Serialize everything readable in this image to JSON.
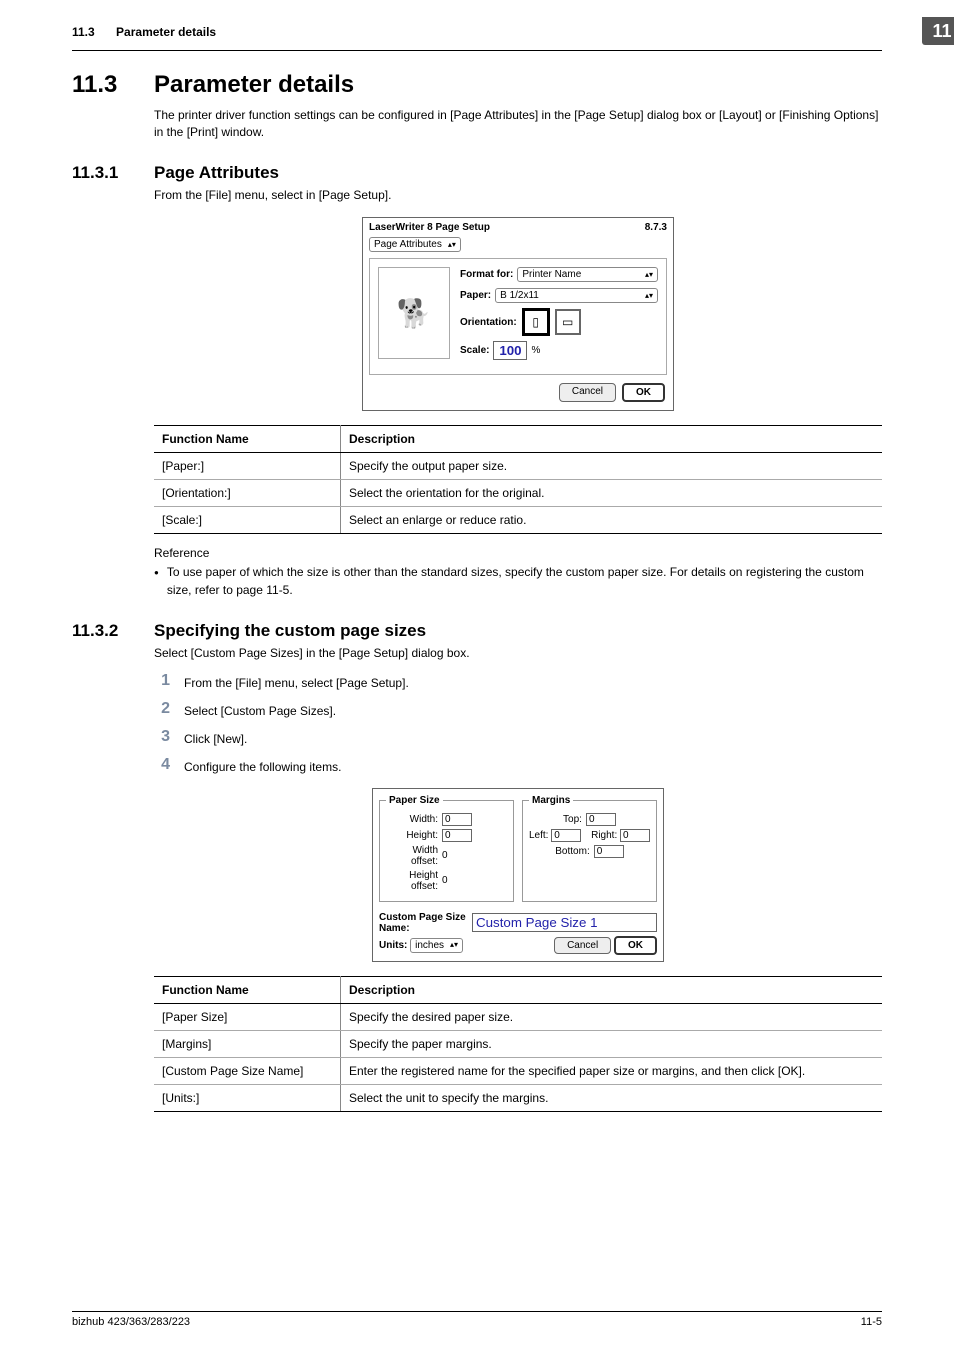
{
  "header": {
    "section_no": "11.3",
    "section_name": "Parameter details",
    "chapter": "11"
  },
  "h1": {
    "num": "11.3",
    "title": "Parameter details"
  },
  "intro": "The printer driver function settings can be configured in [Page Attributes] in the [Page Setup] dialog box or [Layout] or [Finishing Options] in the [Print] window.",
  "s1": {
    "num": "11.3.1",
    "title": "Page Attributes",
    "lead": "From the [File] menu, select in [Page Setup].",
    "dlg": {
      "title": "LaserWriter 8 Page Setup",
      "version": "8.7.3",
      "tab": "Page Attributes",
      "format_for_label": "Format for:",
      "format_for_value": "Printer Name",
      "paper_label": "Paper:",
      "paper_value": "B 1/2x11",
      "orientation_label": "Orientation:",
      "scale_label": "Scale:",
      "scale_value": "100",
      "scale_suffix": "%",
      "cancel": "Cancel",
      "ok": "OK"
    },
    "table": {
      "h1": "Function Name",
      "h2": "Description",
      "rows": [
        {
          "n": "[Paper:]",
          "d": "Specify the output paper size."
        },
        {
          "n": "[Orientation:]",
          "d": "Select the orientation for the original."
        },
        {
          "n": "[Scale:]",
          "d": "Select an enlarge or reduce ratio."
        }
      ]
    },
    "ref_label": "Reference",
    "ref_item": "To use paper of which the size is other than the standard sizes, specify the custom paper size. For details on registering the custom size, refer to page 11-5."
  },
  "s2": {
    "num": "11.3.2",
    "title": "Specifying the custom page sizes",
    "lead": "Select [Custom Page Sizes] in the [Page Setup] dialog box.",
    "steps": [
      "From the [File] menu, select [Page Setup].",
      "Select [Custom Page Sizes].",
      "Click [New].",
      "Configure the following items."
    ],
    "dlg": {
      "papersize_legend": "Paper Size",
      "margins_legend": "Margins",
      "width_label": "Width:",
      "width_value": "0",
      "height_label": "Height:",
      "height_value": "0",
      "widthoff_label": "Width offset:",
      "widthoff_value": "0",
      "heightoff_label": "Height offset:",
      "heightoff_value": "0",
      "top_label": "Top:",
      "top_value": "0",
      "left_label": "Left:",
      "left_value": "0",
      "right_label": "Right:",
      "right_value": "0",
      "bottom_label": "Bottom:",
      "bottom_value": "0",
      "name_label": "Custom Page Size Name:",
      "name_value": "Custom Page Size 1",
      "units_label": "Units:",
      "units_value": "inches",
      "cancel": "Cancel",
      "ok": "OK"
    },
    "table": {
      "h1": "Function Name",
      "h2": "Description",
      "rows": [
        {
          "n": "[Paper Size]",
          "d": "Specify the desired paper size."
        },
        {
          "n": "[Margins]",
          "d": "Specify the paper margins."
        },
        {
          "n": "[Custom Page Size Name]",
          "d": "Enter the registered name for the specified paper size or margins, and then click [OK]."
        },
        {
          "n": "[Units:]",
          "d": "Select the unit to specify the margins."
        }
      ]
    }
  },
  "footer": {
    "left": "bizhub 423/363/283/223",
    "right": "11-5"
  }
}
